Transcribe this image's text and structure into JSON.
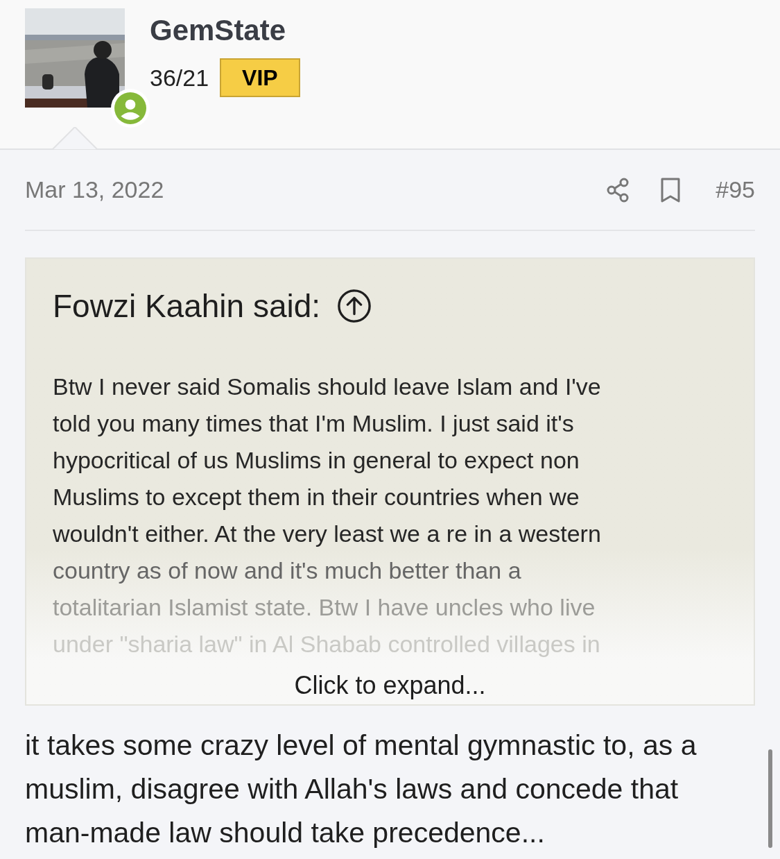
{
  "author": {
    "name": "GemState",
    "stats": "36/21",
    "badge": "VIP",
    "online": true
  },
  "post": {
    "date": "Mar 13, 2022",
    "number": "#95"
  },
  "quote": {
    "title": "Fowzi Kaahin said:",
    "lines": [
      "Btw I never said Somalis should leave Islam and I've",
      "told you many times that I'm Muslim. I just said it's",
      "hypocritical of us Muslims in general to expect non",
      "Muslims to except them in their countries when we",
      "wouldn't either. At the very least we a re in a western",
      "country as of now and it's much better than a",
      "totalitarian Islamist state. Btw I have uncles who live",
      "under \"sharia law\" in Al Shabab controlled villages in"
    ],
    "expand": "Click to expand...",
    "expanded": false
  },
  "message": "it takes some crazy level of mental gymnastic to, as a muslim, disagree with Allah's laws and concede that man-made law should take precedence..."
}
